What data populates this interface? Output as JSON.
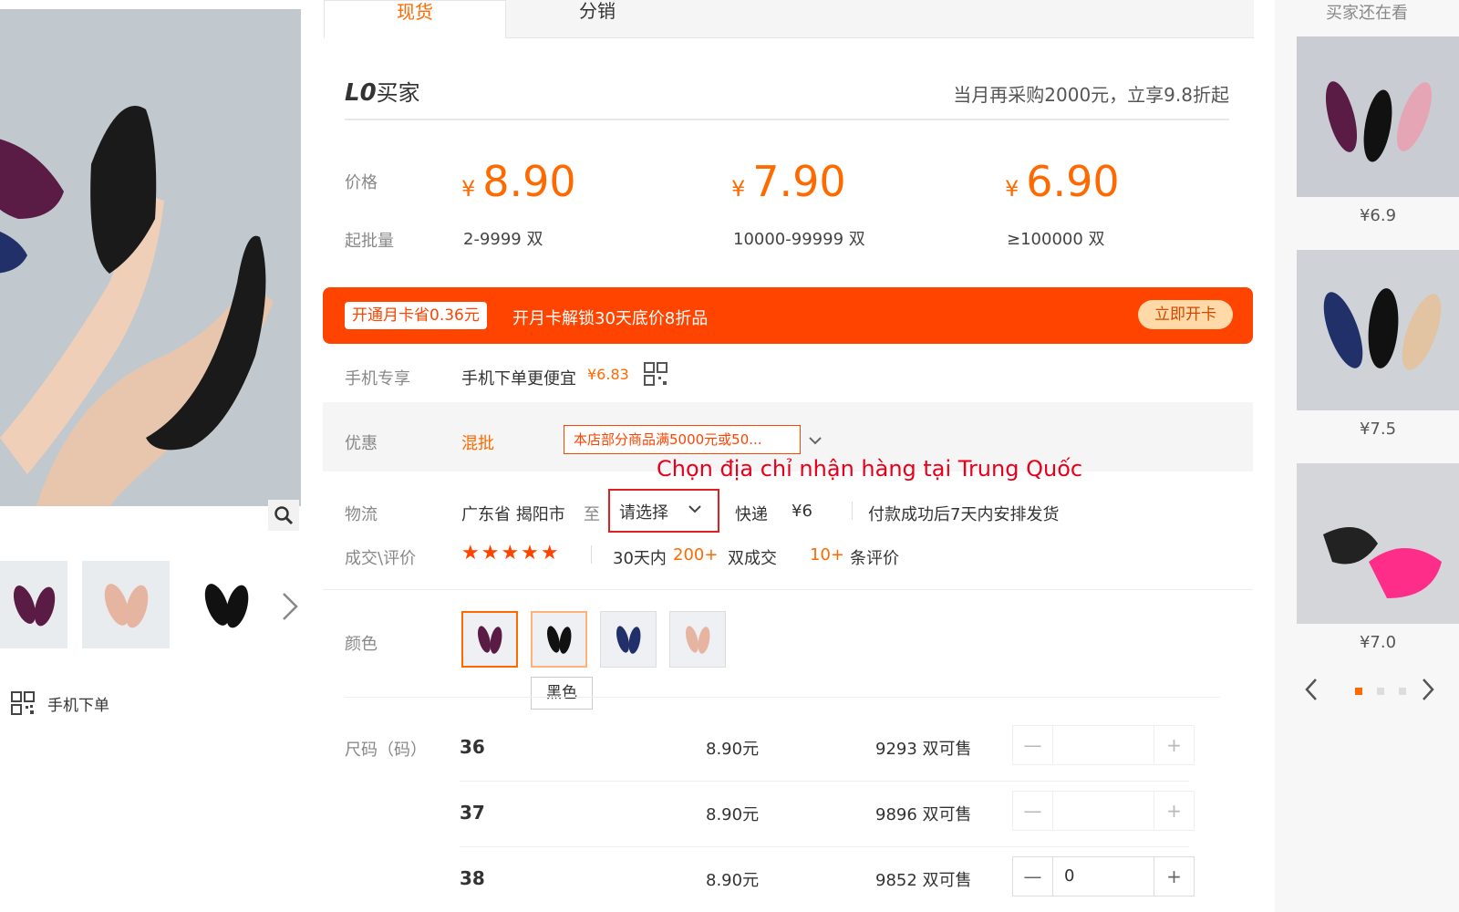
{
  "tabs": [
    {
      "label": "现货"
    },
    {
      "label": "分销"
    }
  ],
  "buyer": {
    "level": "L0",
    "level_suffix": "买家",
    "promo": "当月再采购2000元，立享9.8折起"
  },
  "price_section": {
    "price_label": "价格",
    "qty_label": "起批量",
    "currency": "¥",
    "tiers": [
      {
        "price": "8.90",
        "qty": "2-9999 双"
      },
      {
        "price": "7.90",
        "qty": "10000-99999 双"
      },
      {
        "price": "6.90",
        "qty": "≥100000 双"
      }
    ]
  },
  "banner": {
    "chip": "开通月卡省0.36元",
    "message": "开月卡解锁30天底价8折品",
    "button": "立即开卡"
  },
  "mobile_exclusive": {
    "label": "手机专享",
    "text": "手机下单更便宜",
    "price": "¥6.83"
  },
  "discount": {
    "label": "优惠",
    "type": "混批",
    "coupon": "本店部分商品满5000元或50..."
  },
  "annotation": "Chọn địa chỉ nhận hàng tại Trung Quốc",
  "logistics": {
    "label": "物流",
    "origin": "广东省 揭阳市",
    "to": "至",
    "select_placeholder": "请选择",
    "method": "快递",
    "fee": "¥6",
    "ship_note": "付款成功后7天内安排发货"
  },
  "reviews": {
    "label": "成交\\评价",
    "stars": "★★★★★",
    "period": "30天内",
    "deals": "200+",
    "deals_unit": "双成交",
    "review_count": "10+",
    "review_unit": "条评价"
  },
  "color": {
    "label": "颜色",
    "tooltip": "黑色"
  },
  "sizes": {
    "label": "尺码（码）",
    "rows": [
      {
        "size": "36",
        "price": "8.90元",
        "stock": "9293 双可售",
        "count": ""
      },
      {
        "size": "37",
        "price": "8.90元",
        "stock": "9896 双可售",
        "count": ""
      },
      {
        "size": "38",
        "price": "8.90元",
        "stock": "9852 双可售",
        "count": "0"
      }
    ],
    "minus": "—",
    "plus": "+"
  },
  "left": {
    "mobile_order": "手机下单"
  },
  "sidebar": {
    "title": "买家还在看",
    "items": [
      {
        "price": "¥6.9"
      },
      {
        "price": "¥7.5"
      },
      {
        "price": "¥7.0"
      }
    ]
  },
  "colors": {
    "accent": "#ff6a00",
    "banner": "#ff4400",
    "annotation": "#e8001b"
  }
}
